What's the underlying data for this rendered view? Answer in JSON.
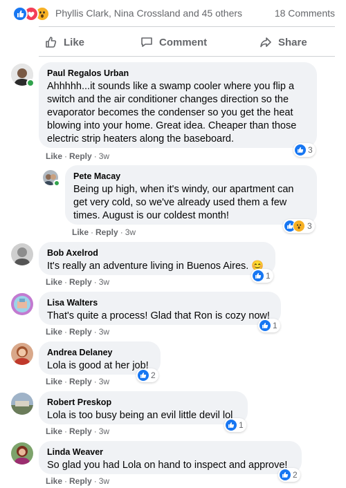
{
  "summary": {
    "reactions": [
      "like-icon",
      "love-icon",
      "wow-icon"
    ],
    "names": "Phyllis Clark, Nina Crossland and 45 others",
    "comments_count": "18 Comments"
  },
  "actions": {
    "like": "Like",
    "comment": "Comment",
    "share": "Share"
  },
  "colors": {
    "like_blue": "#1877f2",
    "love_red": "#f33e58",
    "wow_yellow": "#f7b125",
    "online_green": "#31a24c"
  },
  "comments": [
    {
      "author": "Paul Regalos Urban",
      "text": "Ahhhhh...it sounds like a swamp cooler where you flip a switch and the air conditioner changes direction so the evaporator becomes the condenser so you get the heat blowing into your home. Great idea. Cheaper than those electric strip heaters along the baseboard.",
      "like": "Like",
      "reply": "Reply",
      "time": "3w",
      "reaction_count": "3"
    },
    {
      "author": "Pete Macay",
      "text": "Being up high, when it's windy, our apartment can get very cold, so we've already used them a few times. August is our coldest month!",
      "like": "Like",
      "reply": "Reply",
      "time": "3w",
      "reaction_count": "3"
    },
    {
      "author": "Bob Axelrod",
      "text": "It's really an adventure living in Buenos Aires.",
      "emoji": "😊",
      "like": "Like",
      "reply": "Reply",
      "time": "3w",
      "reaction_count": "1"
    },
    {
      "author": "Lisa Walters",
      "text": "That's quite a process! Glad that Ron is cozy now!",
      "like": "Like",
      "reply": "Reply",
      "time": "3w",
      "reaction_count": "1"
    },
    {
      "author": "Andrea Delaney",
      "text": "Lola is good at her job!",
      "like": "Like",
      "reply": "Reply",
      "time": "3w",
      "reaction_count": "2"
    },
    {
      "author": "Robert Preskop",
      "text": "Lola is too busy being an evil little devil lol",
      "like": "Like",
      "reply": "Reply",
      "time": "3w",
      "reaction_count": "1"
    },
    {
      "author": "Linda Weaver",
      "text": "So glad you had Lola on hand to inspect and approve!",
      "like": "Like",
      "reply": "Reply",
      "time": "3w",
      "reaction_count": "2"
    }
  ]
}
